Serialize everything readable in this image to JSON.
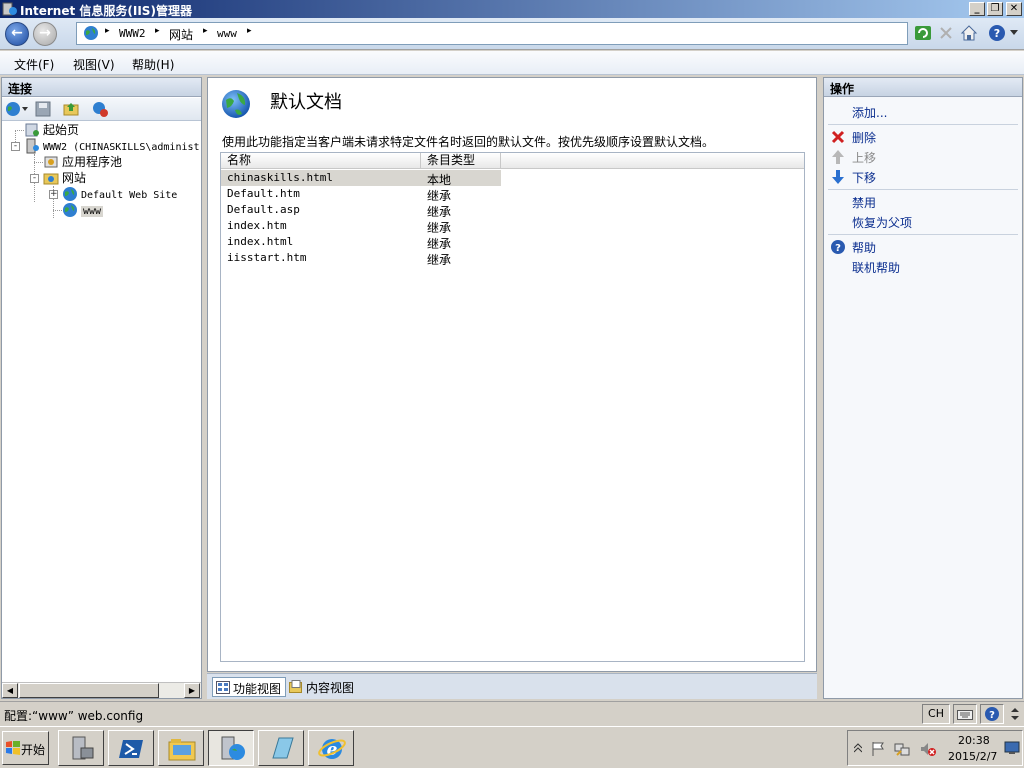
{
  "window": {
    "title": "Internet 信息服务(IIS)管理器",
    "min_label": "_",
    "max_label": "❐",
    "close_label": "✕"
  },
  "address": {
    "crumbs": [
      "WWW2",
      "网站",
      "www"
    ],
    "sep": "▸"
  },
  "menu": {
    "file": "文件(F)",
    "view": "视图(V)",
    "help": "帮助(H)"
  },
  "connections": {
    "title": "连接",
    "tree": {
      "start_page": "起始页",
      "server": "WWW2 (CHINASKILLS\\administ",
      "app_pools": "应用程序池",
      "sites": "网站",
      "default_site": "Default Web Site",
      "www": "www"
    },
    "expand_sign": "-",
    "collapse_sign": "+"
  },
  "center": {
    "title": "默认文档",
    "description": "使用此功能指定当客户端未请求特定文件名时返回的默认文件。按优先级顺序设置默认文档。",
    "columns": [
      "名称",
      "条目类型"
    ],
    "rows": [
      {
        "name": "chinaskills.html",
        "type": "本地"
      },
      {
        "name": "Default.htm",
        "type": "继承"
      },
      {
        "name": "Default.asp",
        "type": "继承"
      },
      {
        "name": "index.htm",
        "type": "继承"
      },
      {
        "name": "index.html",
        "type": "继承"
      },
      {
        "name": "iisstart.htm",
        "type": "继承"
      }
    ],
    "selected_row": 0,
    "tabs": {
      "features": "功能视图",
      "content": "内容视图"
    }
  },
  "actions": {
    "title": "操作",
    "add": "添加...",
    "remove": "删除",
    "move_up": "上移",
    "move_down": "下移",
    "disable": "禁用",
    "revert": "恢复为父项",
    "help": "帮助",
    "online_help": "联机帮助"
  },
  "status": {
    "text": "配置:“www” web.config",
    "lang": "CH"
  },
  "taskbar": {
    "start": "开始",
    "time": "20:38",
    "date": "2015/2/7"
  },
  "colors": {
    "accent": "#0a246a",
    "link": "#0b2e8f",
    "selected_row": "#d8d6d0"
  }
}
